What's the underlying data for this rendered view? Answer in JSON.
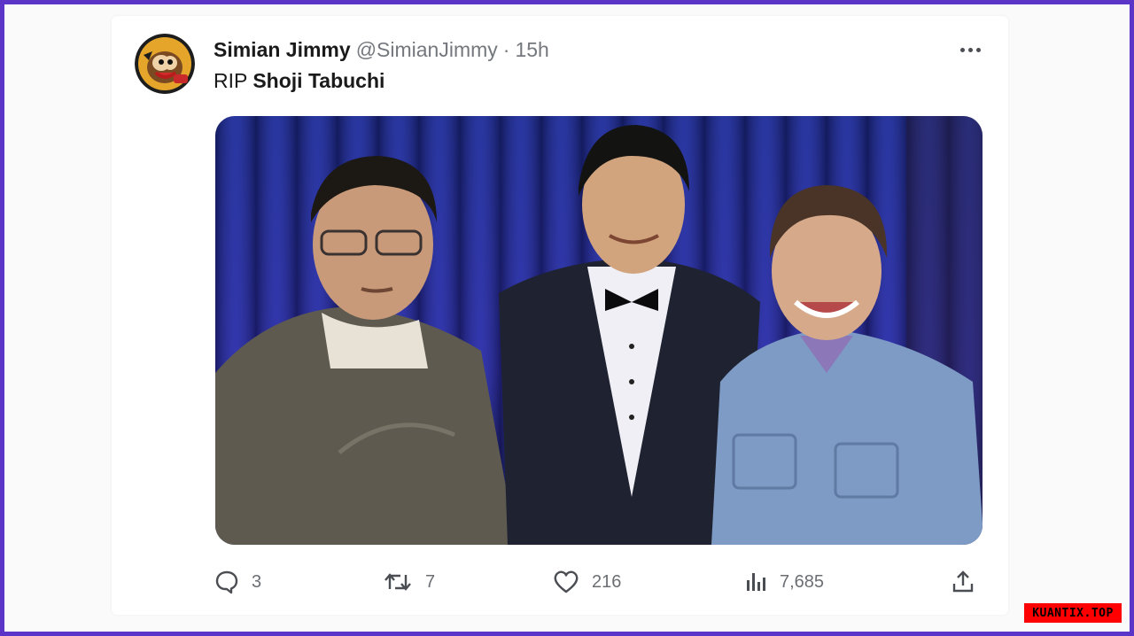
{
  "tweet": {
    "display_name": "Simian Jimmy",
    "handle": "@SimianJimmy",
    "separator": "·",
    "time": "15h",
    "text_prefix": "RIP",
    "text_bold": "Shoji Tabuchi",
    "avatar_icon": "avatar-cartoon-icon",
    "more_icon": "more-icon"
  },
  "actions": {
    "replies": "3",
    "retweets": "7",
    "likes": "216",
    "views": "7,685"
  },
  "icons": {
    "reply": "reply-icon",
    "retweet": "retweet-icon",
    "like": "heart-icon",
    "views": "bar-chart-icon",
    "share": "share-icon"
  },
  "watermark": "KUANTIX.TOP",
  "colors": {
    "frame_border": "#5b34c8",
    "text_primary": "#1a1a1a",
    "text_secondary": "#74787d",
    "watermark_bg": "#ff0000"
  }
}
